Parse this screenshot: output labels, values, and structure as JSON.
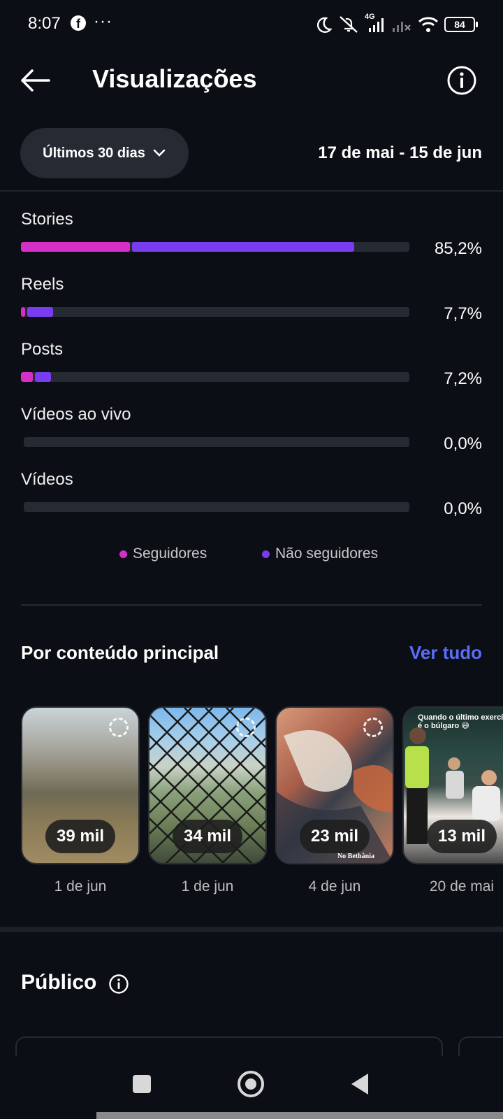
{
  "status_bar": {
    "time": "8:07",
    "facebook_icon": "f",
    "more_dots": "···",
    "network": "4G",
    "battery": "84",
    "icons": [
      "moon-icon",
      "mute-icon",
      "signal-icon",
      "signal-off-icon",
      "wifi-icon",
      "battery-icon"
    ]
  },
  "header": {
    "title": "Visualizações",
    "back_icon": "arrow-left-icon",
    "info_icon": "info-icon"
  },
  "filter": {
    "label": "Últimos 30 dias",
    "date_range": "17 de mai - 15 de jun"
  },
  "content_types": [
    {
      "label": "Stories",
      "value": "85,2%",
      "followers_pct": 28,
      "non_followers_pct": 57.2
    },
    {
      "label": "Reels",
      "value": "7,7%",
      "followers_pct": 1,
      "non_followers_pct": 6.7
    },
    {
      "label": "Posts",
      "value": "7,2%",
      "followers_pct": 3,
      "non_followers_pct": 4.2
    },
    {
      "label": "Vídeos ao vivo",
      "value": "0,0%",
      "followers_pct": 0,
      "non_followers_pct": 0
    },
    {
      "label": "Vídeos",
      "value": "0,0%",
      "followers_pct": 0,
      "non_followers_pct": 0
    }
  ],
  "legend": {
    "followers": "Seguidores",
    "non_followers": "Não seguidores"
  },
  "colors": {
    "followers": "#d62fc8",
    "non_followers": "#7a3cf0",
    "link": "#5b6df8",
    "background": "#0b0e14"
  },
  "top_content": {
    "title": "Por conteúdo principal",
    "see_all": "Ver tudo",
    "items": [
      {
        "count": "39 mil",
        "date": "1 de jun"
      },
      {
        "count": "34 mil",
        "date": "1 de jun"
      },
      {
        "count": "23 mil",
        "date": "4 de jun",
        "watermark": "No Bethânia"
      },
      {
        "count": "13 mil",
        "date": "20 de mai",
        "caption": "Quando o último exercício é o búlgaro 😅"
      }
    ]
  },
  "audience": {
    "title": "Público",
    "info_icon": "info-icon"
  },
  "nav": {
    "recents": "square-icon",
    "home": "circle-icon",
    "back": "triangle-back-icon"
  }
}
